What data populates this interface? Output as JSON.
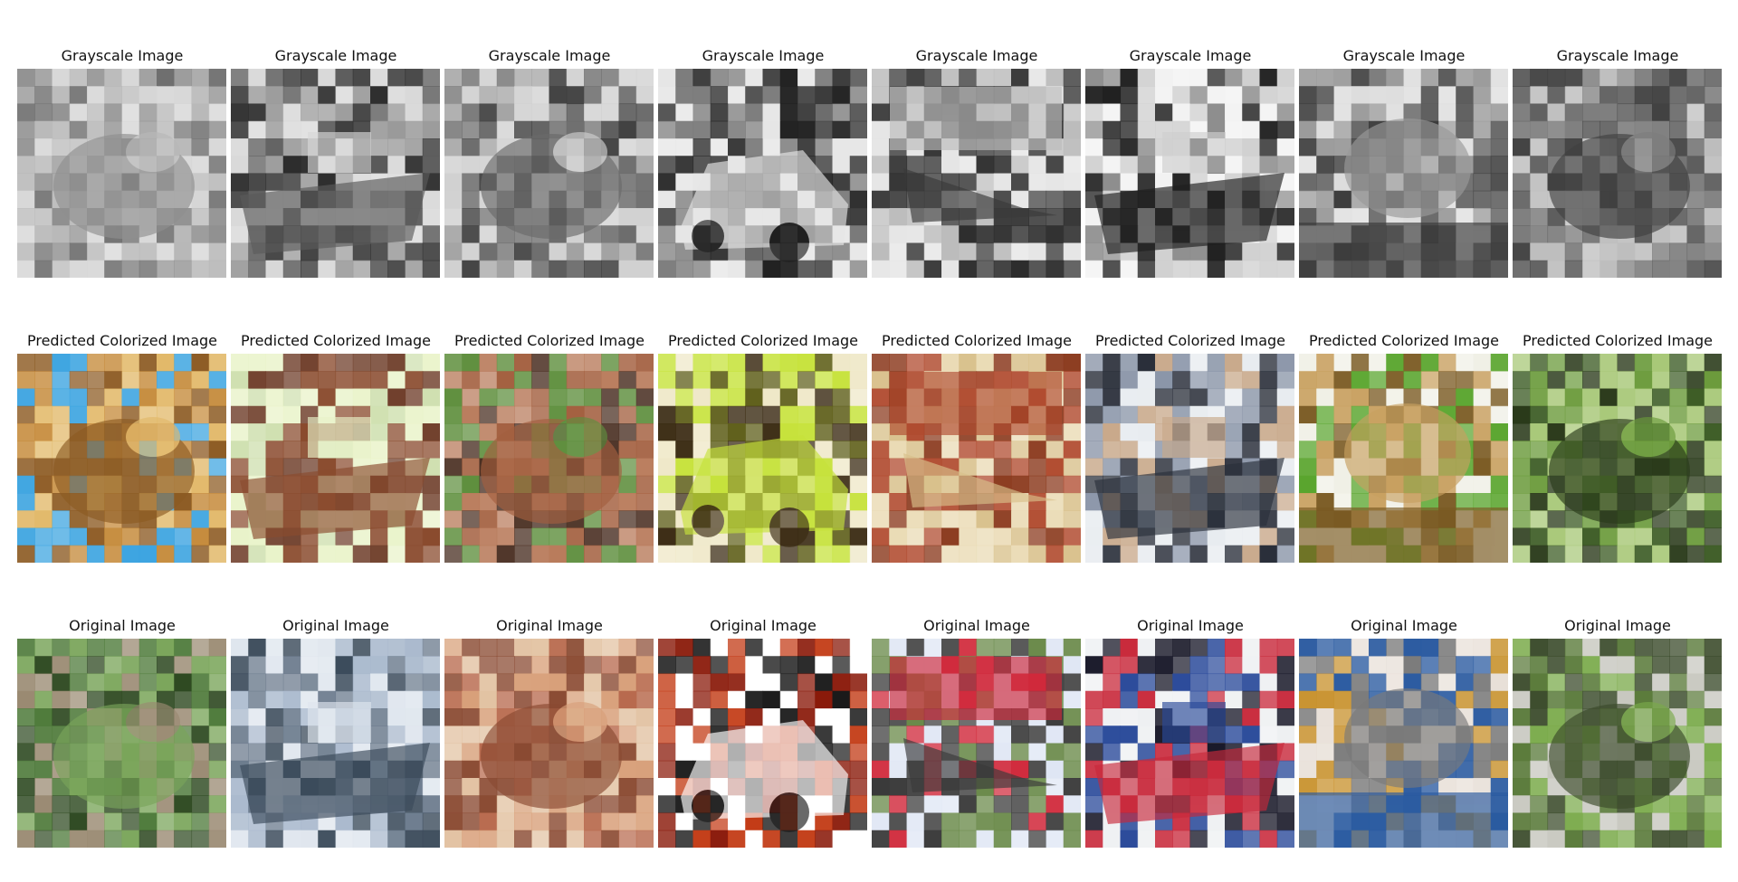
{
  "figure": {
    "rows": [
      {
        "title": "Grayscale Image",
        "panels": [
          {
            "subject": "frog-in-grass",
            "tones": [
              "#6f6f6f",
              "#b8b8b8",
              "#8f8f8f",
              "#d6d6d6"
            ]
          },
          {
            "subject": "boat",
            "tones": [
              "#9a9a9a",
              "#d8d8d8",
              "#5a5a5a",
              "#2b2b2b"
            ]
          },
          {
            "subject": "frog-on-ground",
            "tones": [
              "#a0a0a0",
              "#d0d0d0",
              "#6a6a6a",
              "#3c3c3c"
            ]
          },
          {
            "subject": "car",
            "tones": [
              "#3a3a3a",
              "#e6e6e6",
              "#1f1f1f",
              "#7a7a7a"
            ]
          },
          {
            "subject": "airplane-on-book",
            "tones": [
              "#e4e4e4",
              "#bcbcbc",
              "#3a3a3a",
              "#2a2a2a"
            ]
          },
          {
            "subject": "ship",
            "tones": [
              "#f2f2f2",
              "#cfcfcf",
              "#1e1e1e",
              "#8c8c8c"
            ]
          },
          {
            "subject": "cat",
            "tones": [
              "#5a5a5a",
              "#3a3a3a",
              "#9a9a9a",
              "#dddddd"
            ]
          },
          {
            "subject": "frog-green",
            "tones": [
              "#5e5e5e",
              "#7d7d7d",
              "#404040",
              "#bdbdbd"
            ]
          }
        ]
      },
      {
        "title": "Predicted Colorized Image",
        "panels": [
          {
            "subject": "frog-in-grass",
            "tones": [
              "#c58a3a",
              "#e2b96a",
              "#8c5a22",
              "#3aa3e0"
            ]
          },
          {
            "subject": "boat",
            "tones": [
              "#cfe0b0",
              "#e9f3c9",
              "#8a4b2e",
              "#6f3e2a"
            ]
          },
          {
            "subject": "frog-on-ground",
            "tones": [
              "#b87a5a",
              "#5f8f3e",
              "#a35f3f",
              "#4a2f22"
            ]
          },
          {
            "subject": "car",
            "tones": [
              "#5f5f1a",
              "#c6e23a",
              "#3a2a12",
              "#efe8c8"
            ]
          },
          {
            "subject": "airplane-on-book",
            "tones": [
              "#eadbb5",
              "#b04a2e",
              "#d8c08a",
              "#8b3a1e"
            ]
          },
          {
            "subject": "ship",
            "tones": [
              "#e8ecf0",
              "#c8a88a",
              "#2a2f3a",
              "#8a95a8"
            ]
          },
          {
            "subject": "cat",
            "tones": [
              "#5aa52e",
              "#7a5a22",
              "#c8a060",
              "#f0f0e6"
            ]
          },
          {
            "subject": "frog-green",
            "tones": [
              "#3a5a22",
              "#6a9a3a",
              "#2a3a1a",
              "#a8c878"
            ]
          }
        ]
      },
      {
        "title": "Original Image",
        "panels": [
          {
            "subject": "frog-in-grass",
            "tones": [
              "#4e7a3a",
              "#9a8a72",
              "#7aa55a",
              "#2f4a22"
            ]
          },
          {
            "subject": "boat",
            "tones": [
              "#a8b8cc",
              "#dfe6ee",
              "#3a4a5a",
              "#6a7a8c"
            ]
          },
          {
            "subject": "frog-on-ground",
            "tones": [
              "#b86a4e",
              "#d8a07a",
              "#8a4a32",
              "#e2c2a2"
            ]
          },
          {
            "subject": "car",
            "tones": [
              "#c23a14",
              "#ffffff",
              "#1a1a1a",
              "#8a1a0a"
            ]
          },
          {
            "subject": "airplane-on-book",
            "tones": [
              "#dfe6f4",
              "#d0283a",
              "#3a3a3a",
              "#6a8a4a"
            ]
          },
          {
            "subject": "ship",
            "tones": [
              "#eef0f2",
              "#2a4a9a",
              "#c8283a",
              "#1a1a2a"
            ]
          },
          {
            "subject": "cat",
            "tones": [
              "#c8922e",
              "#2a5aa0",
              "#7a7a7a",
              "#e8e0d8"
            ]
          },
          {
            "subject": "frog-green",
            "tones": [
              "#5a7a3a",
              "#7aaa4a",
              "#3a4a2a",
              "#c8c8c0"
            ]
          }
        ]
      }
    ]
  }
}
